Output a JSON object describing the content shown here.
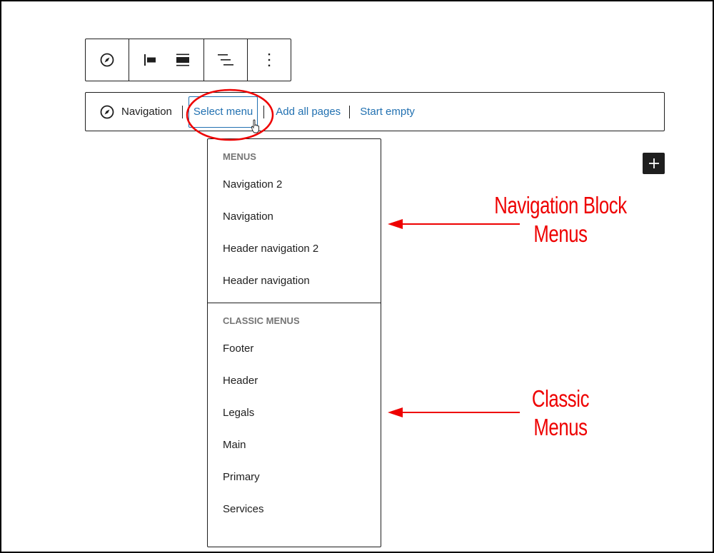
{
  "toolbar": {
    "buttons": [
      {
        "name": "navigation-block-icon",
        "tooltip": "Navigation"
      },
      {
        "name": "align-left-icon",
        "tooltip": "Align left"
      },
      {
        "name": "align-wide-icon",
        "tooltip": "Wide width"
      },
      {
        "name": "justify-icon",
        "tooltip": "Justification"
      },
      {
        "name": "more-options-icon",
        "tooltip": "Options"
      }
    ]
  },
  "placeholder": {
    "label": "Navigation",
    "actions": {
      "select_menu": "Select menu",
      "add_all_pages": "Add all pages",
      "start_empty": "Start empty"
    }
  },
  "dropdown": {
    "menus_title": "MENUS",
    "menus": [
      "Navigation 2",
      "Navigation",
      "Header navigation 2",
      "Header navigation"
    ],
    "classic_title": "CLASSIC MENUS",
    "classic_menus": [
      "Footer",
      "Header",
      "Legals",
      "Main",
      "Primary",
      "Services"
    ]
  },
  "annotations": {
    "nav_block_line1": "Navigation Block",
    "nav_block_line2": "Menus",
    "classic_line1": "Classic",
    "classic_line2": "Menus"
  },
  "colors": {
    "accent": "#2271b1",
    "annotation": "#ee0000",
    "text": "#1e1e1e",
    "muted": "#757575"
  }
}
